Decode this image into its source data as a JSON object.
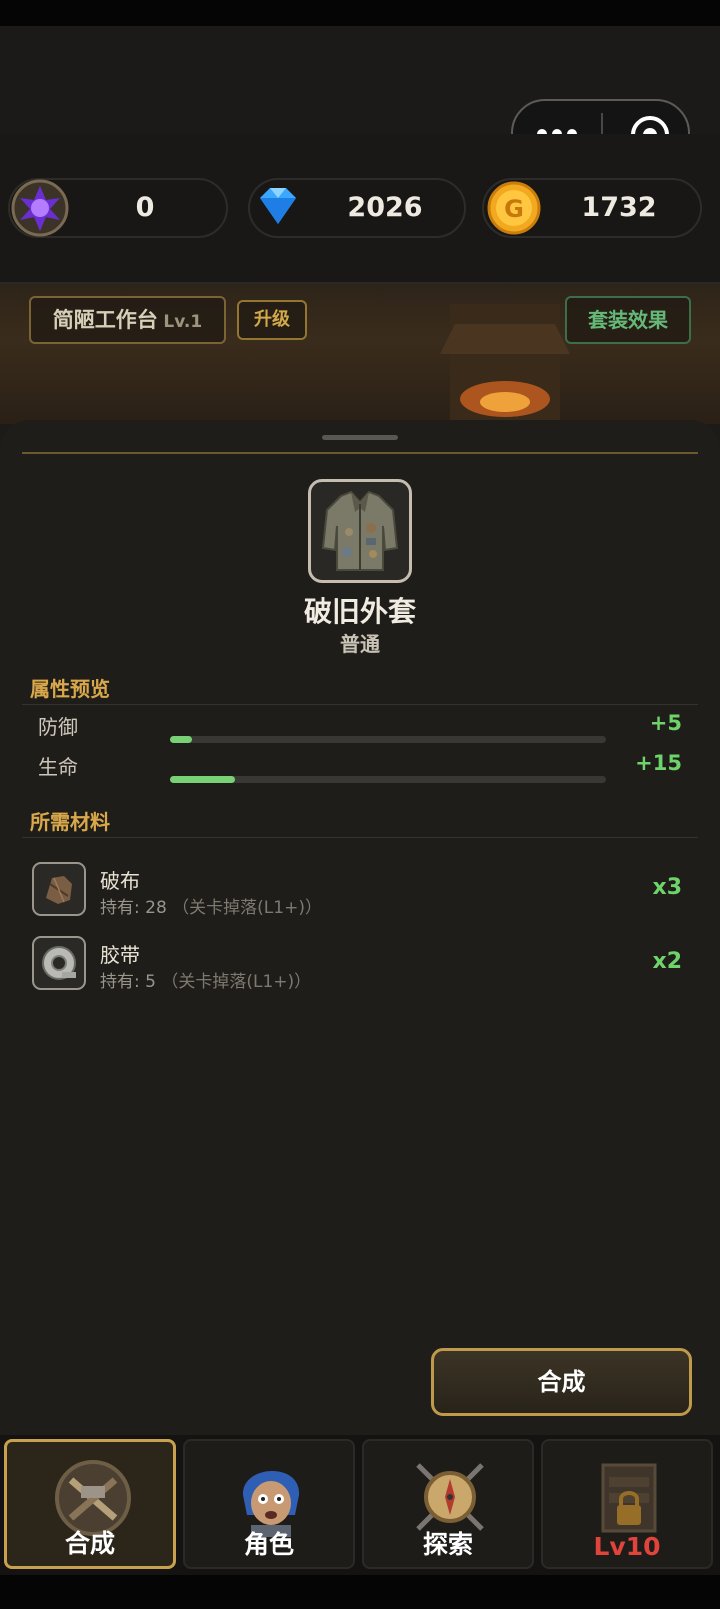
{
  "resources": [
    {
      "name": "purple-crystal",
      "value": "0"
    },
    {
      "name": "diamond",
      "value": "2026"
    },
    {
      "name": "gold-coin",
      "value": "1732"
    }
  ],
  "workbench": {
    "name": "简陋工作台",
    "level": "Lv.1",
    "upgrade_label": "升级",
    "set_effect_label": "套装效果"
  },
  "item": {
    "name": "破旧外套",
    "rarity": "普通",
    "icon": "jacket-icon"
  },
  "stats": {
    "title": "属性预览",
    "rows": [
      {
        "label": "防御",
        "value": "+5",
        "fill": 0.05
      },
      {
        "label": "生命",
        "value": "+15",
        "fill": 0.15
      }
    ]
  },
  "materials": {
    "title": "所需材料",
    "items": [
      {
        "name": "破布",
        "have": "持有: 28",
        "source": "（关卡掉落(L1+)）",
        "qty": "x3",
        "icon": "rag-icon"
      },
      {
        "name": "胶带",
        "have": "持有: 5",
        "source": "（关卡掉落(L1+)）",
        "qty": "x2",
        "icon": "tape-icon"
      }
    ]
  },
  "craft_label": "合成",
  "tabs": [
    {
      "label": "合成",
      "icon": "craft-icon",
      "active": true
    },
    {
      "label": "角色",
      "icon": "character-icon"
    },
    {
      "label": "探索",
      "icon": "compass-icon"
    },
    {
      "label": "Lv10",
      "icon": "locked-shop-icon",
      "color": "#e0443a"
    }
  ],
  "colors": {
    "accent_gold": "#c9a04e",
    "stat_green": "#6ed46a",
    "section_gold": "#d9a84a",
    "locked_red": "#e0443a"
  }
}
